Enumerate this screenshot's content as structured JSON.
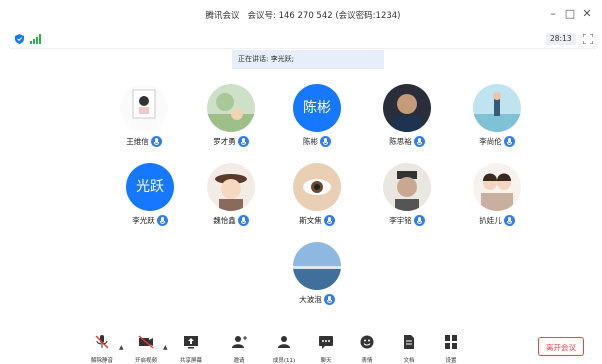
{
  "titlebar": {
    "app_name": "腾讯会议",
    "meeting_id_label": "会议号:",
    "meeting_id": "146 270 542",
    "password": "(会议密码:1234)"
  },
  "status": {
    "timer": "28:13"
  },
  "speaking": {
    "text": "正在讲话: 李光跃;"
  },
  "participants": [
    {
      "name": "王维信",
      "avatar_type": "image"
    },
    {
      "name": "罗才勇",
      "avatar_type": "image"
    },
    {
      "name": "陈彬",
      "avatar_type": "text",
      "avatar_text": "陈彬"
    },
    {
      "name": "陈思裕",
      "avatar_type": "image"
    },
    {
      "name": "李尚伦",
      "avatar_type": "image"
    },
    {
      "name": "李光跃",
      "avatar_type": "text",
      "avatar_text": "光跃"
    },
    {
      "name": "魏怡鑫",
      "avatar_type": "image"
    },
    {
      "name": "斯文焦",
      "avatar_type": "image"
    },
    {
      "name": "李宇铭",
      "avatar_type": "image"
    },
    {
      "name": "扒娃儿",
      "avatar_type": "image"
    },
    {
      "name": "大波泡",
      "avatar_type": "image"
    }
  ],
  "toolbar": {
    "mute": "解除静音",
    "video": "开启视频",
    "share": "共享屏幕",
    "invite": "邀请",
    "members": "成员(11)",
    "chat": "聊天",
    "emoji": "表情",
    "docs": "文档",
    "settings": "设置",
    "leave": "离开会议"
  },
  "colors": {
    "accent": "#1677ff",
    "leave": "#ee4444",
    "speaking_bg": "#e6eef9"
  }
}
